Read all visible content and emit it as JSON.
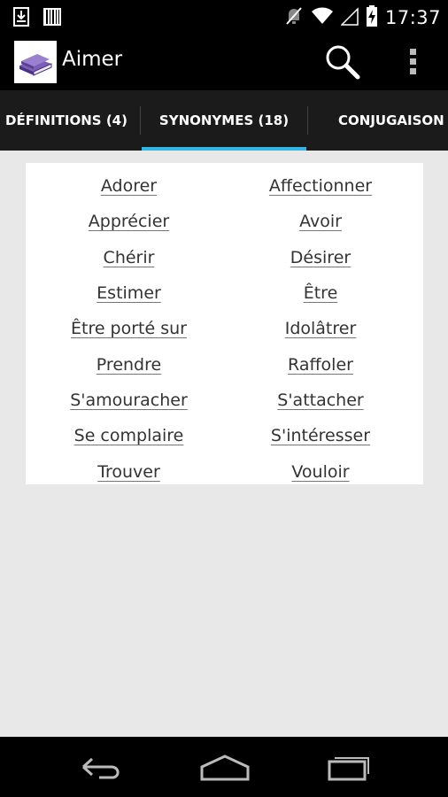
{
  "status_bar": {
    "time": "17:37",
    "icons": [
      "download-icon",
      "barcode-icon",
      "mute-icon",
      "wifi-icon",
      "signal-icon",
      "battery-charging-icon"
    ]
  },
  "action_bar": {
    "title": "Aimer",
    "icons": [
      "book-icon",
      "search-icon",
      "overflow-menu-icon"
    ]
  },
  "tabs": [
    {
      "label": "DÉFINITIONS (4)",
      "selected": false
    },
    {
      "label": "SYNONYMES (18)",
      "selected": true
    },
    {
      "label": "CONJUGAISON",
      "selected": false
    }
  ],
  "colors": {
    "tab_indicator": "#33b5e5",
    "bar_background": "#000000",
    "content_background": "#e8e8e8"
  },
  "synonyms": [
    "Adorer",
    "Affectionner",
    "Apprécier",
    "Avoir",
    "Chérir",
    "Désirer",
    "Estimer",
    "Être",
    "Être porté sur",
    "Idolâtrer",
    "Prendre",
    "Raffoler",
    "S'amouracher",
    "S'attacher",
    "Se complaire",
    "S'intéresser",
    "Trouver",
    "Vouloir"
  ],
  "nav_bar": {
    "icons": [
      "back-icon",
      "home-icon",
      "recents-icon"
    ]
  }
}
